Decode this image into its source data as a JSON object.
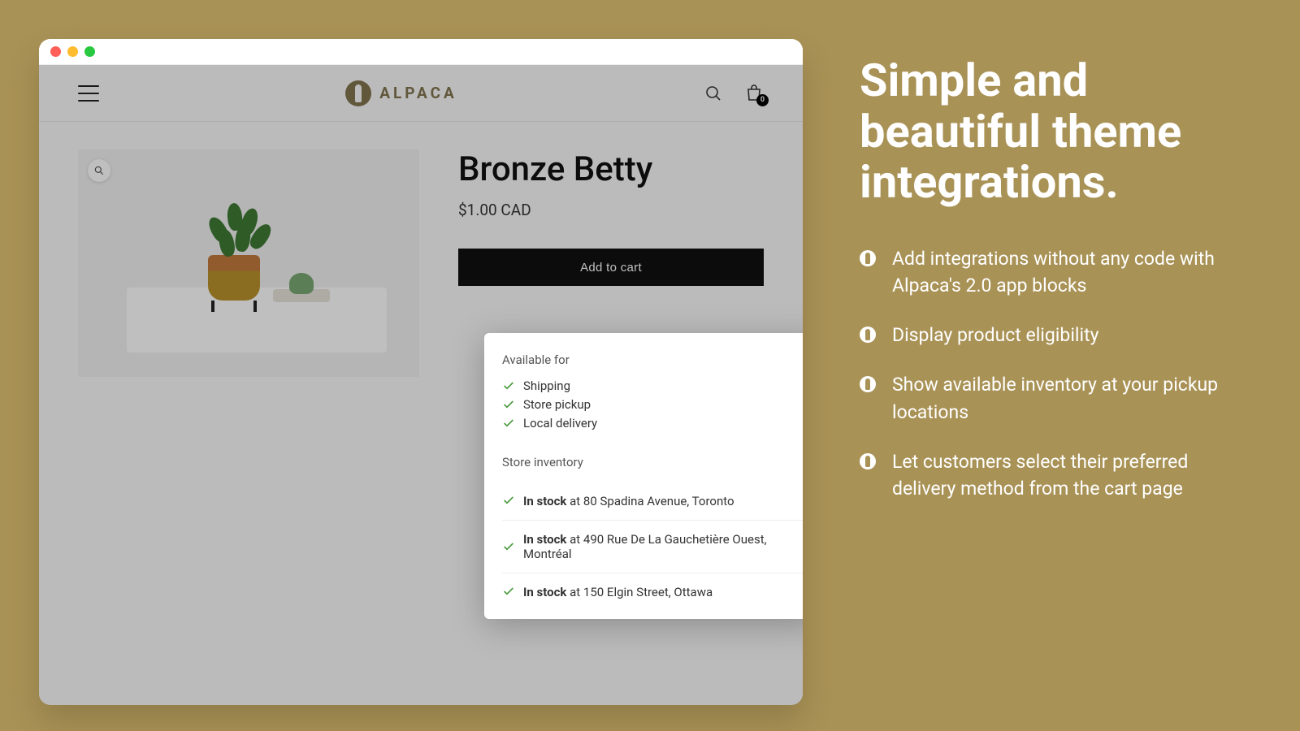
{
  "browser": {
    "brand_text": "ALPACA",
    "cart_count": "0"
  },
  "product": {
    "title": "Bronze Betty",
    "price": "$1.00 CAD",
    "add_to_cart_label": "Add to cart"
  },
  "availability": {
    "available_for_title": "Available for",
    "options": [
      {
        "label": "Shipping"
      },
      {
        "label": "Store pickup"
      },
      {
        "label": "Local delivery"
      }
    ],
    "inventory_title": "Store inventory",
    "inventory": [
      {
        "status": "In stock",
        "location": " at 80 Spadina Avenue, Toronto"
      },
      {
        "status": "In stock",
        "location": " at 490 Rue De La Gauchetière Ouest, Montréal"
      },
      {
        "status": "In stock",
        "location": " at 150 Elgin Street, Ottawa"
      }
    ]
  },
  "marketing": {
    "heading": "Simple and beautiful theme integrations.",
    "bullets": [
      "Add integrations without any code with Alpaca's 2.0 app blocks",
      "Display product eligibility",
      "Show available inventory at your pickup locations",
      "Let customers select their preferred delivery method from the cart page"
    ]
  }
}
